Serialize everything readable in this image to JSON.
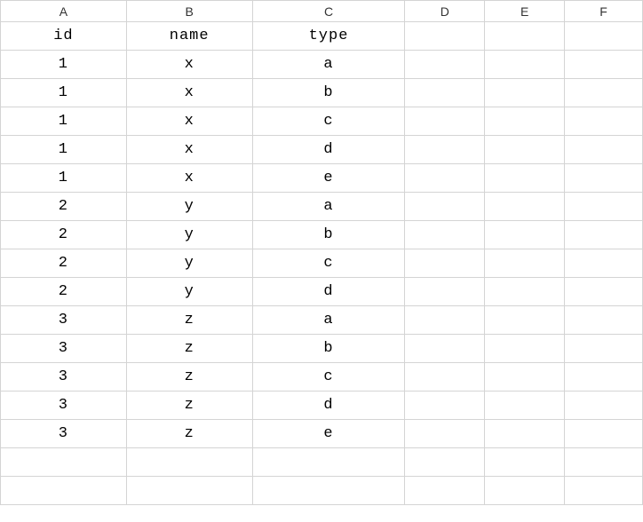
{
  "columns": {
    "a": "A",
    "b": "B",
    "c": "C",
    "d": "D",
    "e": "E",
    "f": "F"
  },
  "rows": [
    {
      "a": "id",
      "b": "name",
      "c": "type",
      "d": "",
      "e": "",
      "f": ""
    },
    {
      "a": "1",
      "b": "x",
      "c": "a",
      "d": "",
      "e": "",
      "f": ""
    },
    {
      "a": "1",
      "b": "x",
      "c": "b",
      "d": "",
      "e": "",
      "f": ""
    },
    {
      "a": "1",
      "b": "x",
      "c": "c",
      "d": "",
      "e": "",
      "f": ""
    },
    {
      "a": "1",
      "b": "x",
      "c": "d",
      "d": "",
      "e": "",
      "f": ""
    },
    {
      "a": "1",
      "b": "x",
      "c": "e",
      "d": "",
      "e": "",
      "f": ""
    },
    {
      "a": "2",
      "b": "y",
      "c": "a",
      "d": "",
      "e": "",
      "f": ""
    },
    {
      "a": "2",
      "b": "y",
      "c": "b",
      "d": "",
      "e": "",
      "f": ""
    },
    {
      "a": "2",
      "b": "y",
      "c": "c",
      "d": "",
      "e": "",
      "f": ""
    },
    {
      "a": "2",
      "b": "y",
      "c": "d",
      "d": "",
      "e": "",
      "f": ""
    },
    {
      "a": "3",
      "b": "z",
      "c": "a",
      "d": "",
      "e": "",
      "f": ""
    },
    {
      "a": "3",
      "b": "z",
      "c": "b",
      "d": "",
      "e": "",
      "f": ""
    },
    {
      "a": "3",
      "b": "z",
      "c": "c",
      "d": "",
      "e": "",
      "f": ""
    },
    {
      "a": "3",
      "b": "z",
      "c": "d",
      "d": "",
      "e": "",
      "f": ""
    },
    {
      "a": "3",
      "b": "z",
      "c": "e",
      "d": "",
      "e": "",
      "f": ""
    },
    {
      "a": "",
      "b": "",
      "c": "",
      "d": "",
      "e": "",
      "f": ""
    },
    {
      "a": "",
      "b": "",
      "c": "",
      "d": "",
      "e": "",
      "f": ""
    }
  ]
}
